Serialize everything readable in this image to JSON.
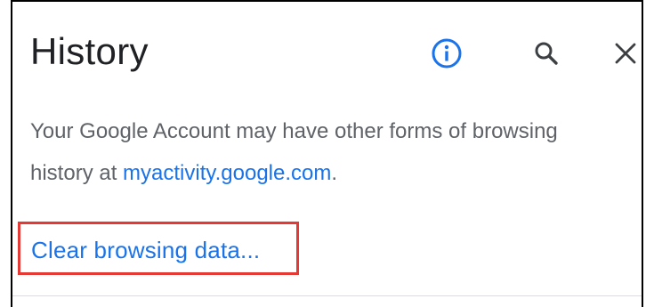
{
  "header": {
    "title": "History"
  },
  "notice": {
    "text_before": "Your Google Account may have other forms of browsing history at ",
    "link_text": "myactivity.google.com",
    "text_after": "."
  },
  "actions": {
    "clear_label": "Clear browsing data..."
  },
  "icons": {
    "info": "info-icon",
    "search": "search-icon",
    "close": "close-icon"
  },
  "colors": {
    "accent": "#1a73e8",
    "title_text": "#202124",
    "body_text": "#5f6368",
    "highlight_box": "#e53935"
  }
}
